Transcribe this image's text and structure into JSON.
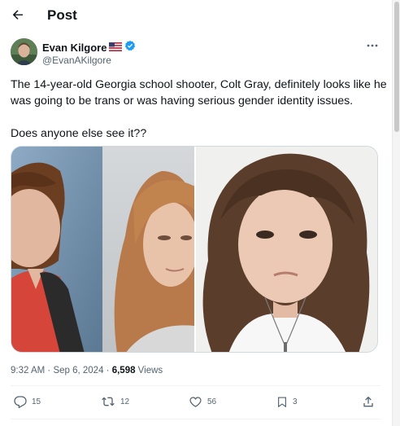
{
  "header": {
    "title": "Post",
    "back_icon": "arrow-left-icon"
  },
  "author": {
    "display_name": "Evan Kilgore",
    "flag_icon": "us-flag-icon",
    "verified_icon": "verified-badge-icon",
    "verified_color": "#1d9bf0",
    "handle": "@EvanAKilgore",
    "more_icon": "more-horizontal-icon"
  },
  "post": {
    "lines": [
      "The 14-year-old Georgia school shooter, Colt Gray, definitely looks like he",
      "was going to be trans or was having serious gender identity issues."
    ],
    "question": "Does anyone else see it??"
  },
  "media": {
    "left_image": "two-side-by-side-portrait-photos",
    "right_image": "portrait-photo"
  },
  "meta": {
    "time": "9:32 AM",
    "separator": " · ",
    "date": "Sep 6, 2024",
    "views_count": "6,598",
    "views_label": " Views"
  },
  "actions": {
    "replies": {
      "icon": "reply-icon",
      "count": "15"
    },
    "reposts": {
      "icon": "repost-icon",
      "count": "12"
    },
    "likes": {
      "icon": "heart-icon",
      "count": "56"
    },
    "bookmarks": {
      "icon": "bookmark-icon",
      "count": "3"
    },
    "share": {
      "icon": "share-icon"
    }
  },
  "colors": {
    "text": "#0f1419",
    "muted": "#536471",
    "accent": "#1d9bf0",
    "border": "#cfd9de"
  }
}
